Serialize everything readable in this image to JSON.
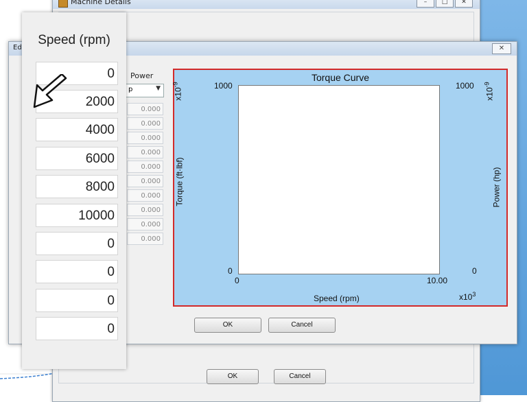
{
  "machine_window": {
    "title": "Machine Details",
    "ok_label": "OK",
    "cancel_label": "Cancel"
  },
  "edit_dialog": {
    "title": "Edi",
    "close_label": "✕",
    "power_column": {
      "header": "Power",
      "unit_value": "p",
      "values": [
        "0.000",
        "0.000",
        "0.000",
        "0.000",
        "0.000",
        "0.000",
        "0.000",
        "0.000",
        "0.000",
        "0.000"
      ]
    },
    "ok_label": "OK",
    "cancel_label": "Cancel"
  },
  "chart_data": {
    "type": "line",
    "title": "Torque Curve",
    "xlabel": "Speed (rpm)",
    "ylabel_left": "Torque (ft·lbf)",
    "ylabel_right": "Power (hp)",
    "x_ticks": [
      "0",
      "10.00"
    ],
    "x_multiplier": "x10",
    "x_multiplier_exp": "3",
    "y_left_ticks": [
      "0",
      "1000"
    ],
    "y_left_multiplier": "x10",
    "y_left_multiplier_exp": "-9",
    "y_right_ticks": [
      "0",
      "1000"
    ],
    "y_right_multiplier": "x10",
    "y_right_multiplier_exp": "-9",
    "xlim": [
      0,
      10000
    ],
    "ylim": [
      0,
      1e-06
    ],
    "series": [],
    "grid": false,
    "colors": {
      "background": "#a6d2f2",
      "border": "#d22a2a",
      "plot": "#ffffff"
    }
  },
  "callout": {
    "header": "Speed (rpm)",
    "values": [
      "0",
      "2000",
      "4000",
      "6000",
      "8000",
      "10000",
      "0",
      "0",
      "0",
      "0"
    ]
  },
  "icons": [
    "mouse-pointer-icon",
    "app-icon",
    "close-icon",
    "dropdown-arrow-icon"
  ]
}
